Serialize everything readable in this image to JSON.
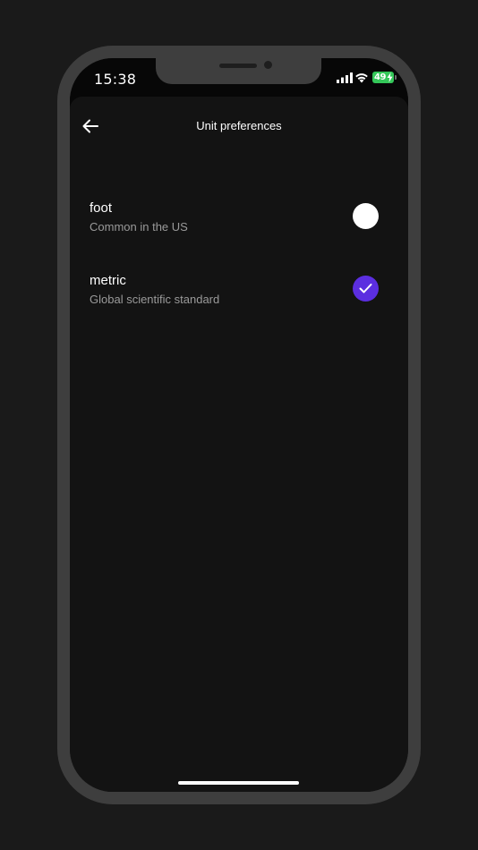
{
  "status_bar": {
    "time": "15:38",
    "battery_level": "49",
    "icons": [
      "cellular-signal-icon",
      "wifi-icon",
      "battery-charging-icon"
    ]
  },
  "header": {
    "title": "Unit preferences",
    "back_icon": "arrow-left-icon"
  },
  "options": [
    {
      "label": "foot",
      "description": "Common in the US",
      "selected": false
    },
    {
      "label": "metric",
      "description": "Global scientific standard",
      "selected": true
    }
  ],
  "colors": {
    "accent": "#5b2ee0",
    "background": "#131313",
    "battery": "#34c759"
  }
}
